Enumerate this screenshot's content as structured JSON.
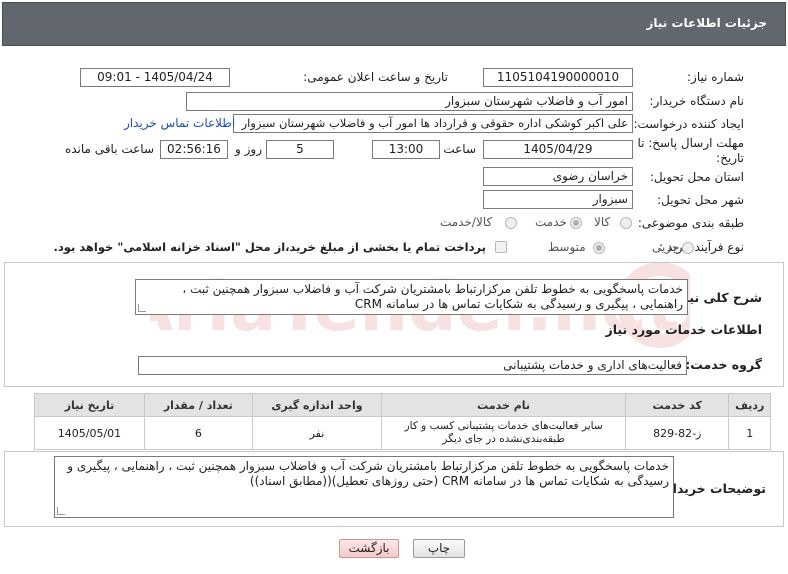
{
  "header": {
    "title": "جزئیات اطلاعات نیاز"
  },
  "form": {
    "need_number_label": "شماره نیاز:",
    "need_number": "1105104190000010",
    "announce_label": "تاریخ و ساعت اعلان عمومی:",
    "announce_value": "1405/04/24 - 09:01",
    "buyer_org_label": "نام دستگاه خریدار:",
    "buyer_org": "امور آب و فاضلاب شهرستان سبزوار",
    "requester_label": "ایجاد کننده درخواست:",
    "requester": "علی اکبر کوشکی اداره حقوقی و قرارداد ها امور آب و فاضلاب شهرستان سبزوار",
    "buyer_contact_link": "اطلاعات تماس خریدار",
    "deadline_label": "مهلت ارسال پاسخ: تا تاریخ:",
    "deadline_date": "1405/04/29",
    "time_label": "ساعت",
    "deadline_time": "13:00",
    "days_value": "5",
    "days_label": "روز و",
    "remaining_time": "02:56:16",
    "remaining_label": "ساعت باقی مانده",
    "province_label": "استان محل تحویل:",
    "province": "خراسان رضوی",
    "city_label": "شهر محل تحویل:",
    "city": "سبزوار",
    "category_label": "طبقه بندی موضوعی:",
    "category_options": [
      "کالا",
      "خدمت",
      "کالا/خدمت"
    ],
    "category_selected": "خدمت",
    "process_label": "نوع فرآیند خرید :",
    "process_options": [
      "جزیی",
      "متوسط"
    ],
    "process_selected": "متوسط",
    "payment_note": "پرداخت تمام یا بخشی از مبلغ خرید،از محل \"اسناد خزانه اسلامی\" خواهد بود."
  },
  "summary": {
    "label": "شرح کلی نیاز:",
    "text": "خدمات پاسخگویی به خطوط تلفن مرکزارتباط بامشتریان شرکت آب و فاضلاب سبزوار همچنین ثبت ، راهنمایی ، پیگیری و رسیدگی به شکایات تماس ها در سامانه CRM"
  },
  "services": {
    "section_title": "اطلاعات خدمات مورد نیاز",
    "group_label": "گروه خدمت:",
    "group_value": "فعالیت‌های اداری و خدمات پشتیبانی",
    "columns": [
      "ردیف",
      "کد خدمت",
      "نام خدمت",
      "واحد اندازه گیری",
      "تعداد / مقدار",
      "تاریخ نیاز"
    ],
    "rows": [
      [
        "1",
        "ز-82-829",
        "سایر فعالیت‌های خدمات پشتیبانی کسب و کار طبقه‌بندی‌نشده در جای دیگر",
        "نفر",
        "6",
        "1405/05/01"
      ]
    ]
  },
  "buyer_notes": {
    "label": "توضیحات خریدار:",
    "text": "خدمات پاسخگویی به خطوط تلفن مرکزارتباط بامشتریان شرکت آب و فاضلاب سبزوار همچنین ثبت ، راهنمایی ، پیگیری و رسیدگی به شکایات تماس ها در سامانه CRM  (حتی روزهای تعطیل)((مطابق اسناد))"
  },
  "buttons": {
    "print": "چاپ",
    "back": "بازگشت"
  },
  "watermark": {
    "text": "AriaTender.net"
  },
  "colors": {
    "titlebar": "#62676e",
    "link": "#1a4fb5",
    "back_button": "#f4c9c9"
  }
}
